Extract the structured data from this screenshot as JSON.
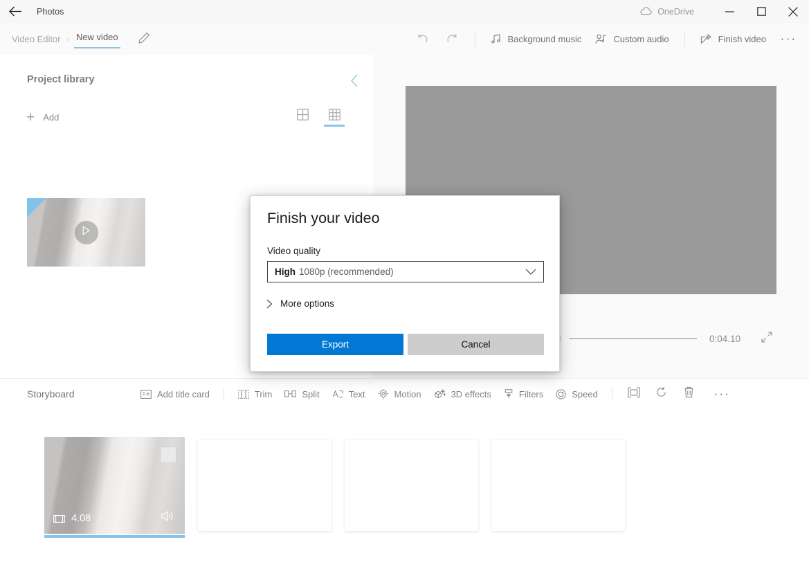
{
  "titlebar": {
    "back_icon": "arrow-left-icon",
    "app_name": "Photos",
    "onedrive_label": "OneDrive",
    "onedrive_icon": "cloud-icon",
    "minimize_label": "Minimize",
    "maximize_label": "Maximize",
    "close_label": "Close"
  },
  "commandbar": {
    "breadcrumb_root": "Video Editor",
    "breadcrumb_sep": "›",
    "breadcrumb_current": "New video",
    "rename_icon": "pencil-icon",
    "undo_icon": "undo-icon",
    "redo_icon": "redo-icon",
    "background_music": "Background music",
    "background_music_icon": "music-note-icon",
    "custom_audio": "Custom audio",
    "custom_audio_icon": "person-audio-icon",
    "finish_video": "Finish video",
    "finish_video_icon": "share-icon",
    "overflow": "···"
  },
  "library": {
    "title": "Project library",
    "collapse_icon": "chevron-left-icon",
    "add_label": "Add",
    "add_icon": "plus-icon",
    "view_grid_large": "grid-2x2-icon",
    "view_grid_small": "grid-3x3-icon",
    "active_view": "grid-3x3-icon",
    "thumbnail_play_icon": "play-icon"
  },
  "preview": {
    "play_icon": "play-icon",
    "timecode": "0:04.10",
    "fullscreen_icon": "expand-icon"
  },
  "storyboard": {
    "title": "Storyboard",
    "tools": [
      {
        "label": "Add title card",
        "icon": "title-card-icon"
      },
      {
        "label": "Trim",
        "icon": "trim-icon"
      },
      {
        "label": "Split",
        "icon": "split-icon"
      },
      {
        "label": "Text",
        "icon": "text-icon"
      },
      {
        "label": "Motion",
        "icon": "motion-icon"
      },
      {
        "label": "3D effects",
        "icon": "3d-effects-icon"
      },
      {
        "label": "Filters",
        "icon": "filters-icon"
      },
      {
        "label": "Speed",
        "icon": "speed-icon"
      }
    ],
    "icon_tools": [
      {
        "icon": "aspect-ratio-icon"
      },
      {
        "icon": "rotate-icon"
      },
      {
        "icon": "delete-icon"
      }
    ],
    "overflow": "···",
    "clip": {
      "duration": "4.08",
      "duration_icon": "filmstrip-icon",
      "volume_icon": "speaker-icon"
    },
    "empty_slots": 3
  },
  "modal": {
    "title": "Finish your video",
    "quality_label": "Video quality",
    "quality_value_strong": "High",
    "quality_value_rest": "1080p (recommended)",
    "quality_chevron_icon": "chevron-down-icon",
    "more_options_label": "More options",
    "more_options_icon": "chevron-right-icon",
    "export_label": "Export",
    "cancel_label": "Cancel"
  },
  "colors": {
    "accent": "#0078d4",
    "accent_light": "#8ec4e8",
    "cancel_bg": "#cdcdcd",
    "stage": "#9a9a9a"
  }
}
